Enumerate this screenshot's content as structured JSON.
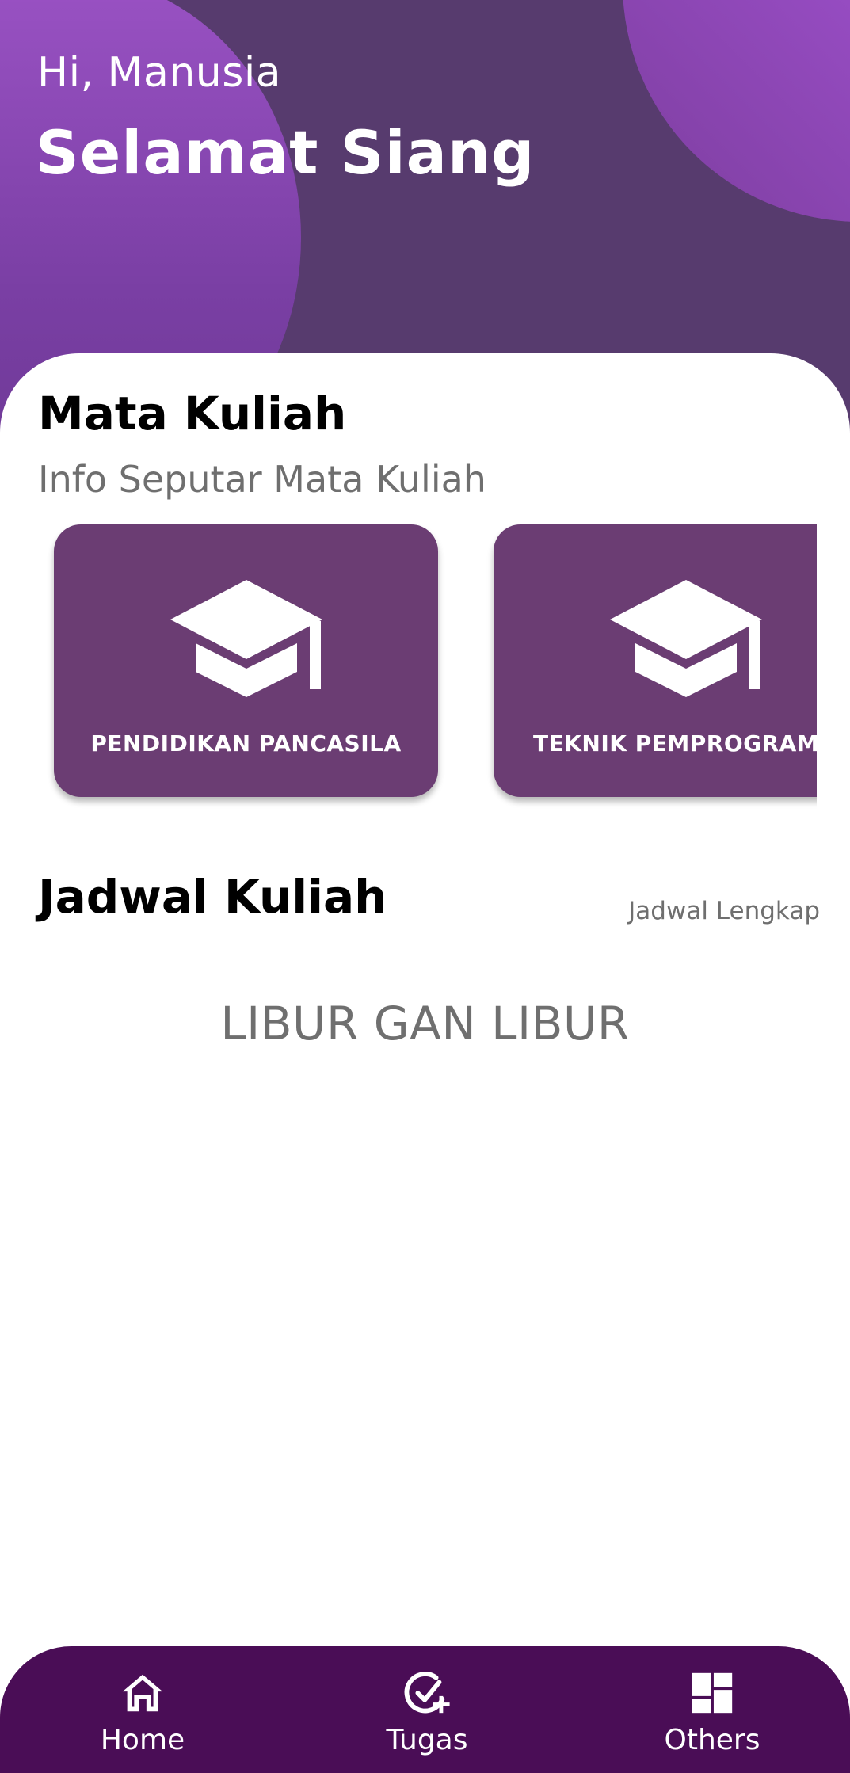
{
  "header": {
    "greeting": "Hi, Manusia",
    "salutation": "Selamat Siang"
  },
  "courses": {
    "title": "Mata Kuliah",
    "subtitle": "Info Seputar Mata Kuliah",
    "items": [
      {
        "name": "PENDIDIKAN PANCASILA",
        "icon": "graduation-cap-icon"
      },
      {
        "name": "TEKNIK PEMPROGRAMA",
        "icon": "graduation-cap-icon"
      }
    ]
  },
  "schedule": {
    "title": "Jadwal Kuliah",
    "link": "Jadwal Lengkap",
    "empty_message": "LIBUR GAN LIBUR"
  },
  "nav": {
    "items": [
      {
        "label": "Home",
        "icon": "home-icon"
      },
      {
        "label": "Tugas",
        "icon": "check-add-icon"
      },
      {
        "label": "Others",
        "icon": "dashboard-icon"
      }
    ]
  },
  "colors": {
    "header_bg": "#573B6E",
    "card_bg": "#6B3D73",
    "nav_bg": "#4A0D56",
    "accent": "#9A52C4"
  }
}
